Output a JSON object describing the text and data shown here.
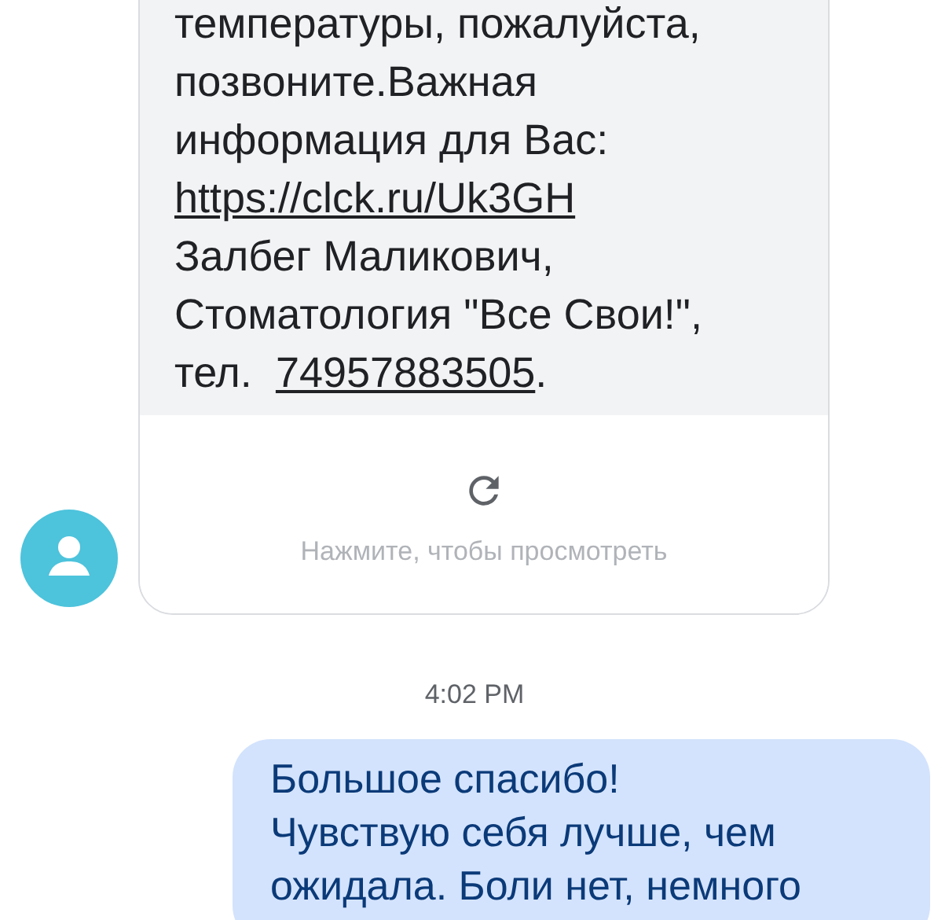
{
  "incoming": {
    "lines": [
      [
        {
          "text": "температуры, пожалуйста,"
        }
      ],
      [
        {
          "text": "позвоните.Важная"
        }
      ],
      [
        {
          "text": "информация для Вас:"
        }
      ],
      [
        {
          "text": "https://clck.ru/Uk3GH",
          "link": true
        }
      ],
      [
        {
          "text": "Залбег Маликович,"
        }
      ],
      [
        {
          "text": "Стоматология \"Все Свои!\","
        }
      ],
      [
        {
          "text": "тел.  "
        },
        {
          "text": "74957883505",
          "link": true
        },
        {
          "text": "."
        }
      ]
    ],
    "preview_hint": "Нажмите, чтобы просмотреть"
  },
  "timestamp": "4:02 PM",
  "outgoing": {
    "text": "Большое спасибо!\nЧувствую себя лучше, чем ожидала. Боли нет, немного"
  }
}
